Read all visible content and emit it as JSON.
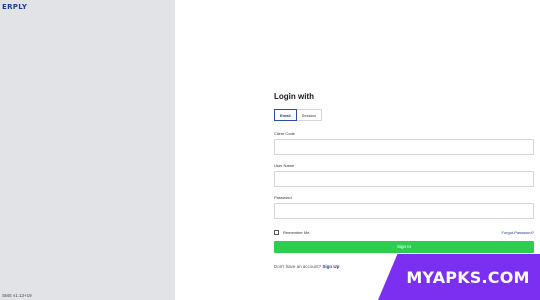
{
  "sidebar": {
    "logo_text": "ERPLY",
    "version": "SMS v1.13+19"
  },
  "login": {
    "title": "Login with",
    "tabs": [
      {
        "label": "Email",
        "active": true
      },
      {
        "label": "Session",
        "active": false
      }
    ],
    "fields": {
      "client_code": {
        "label": "Client Code",
        "value": ""
      },
      "username": {
        "label": "User Name",
        "value": ""
      },
      "password": {
        "label": "Password",
        "value": ""
      }
    },
    "remember_label": "Remember Me",
    "remember_checked": false,
    "forgot_label": "Forgot Password?",
    "signin_label": "Sign In",
    "signup_prompt": "Don't have an account?",
    "signup_link": "Sign Up"
  },
  "watermark": {
    "text": "MYAPKS.COM"
  },
  "colors": {
    "brand_blue": "#1f3e8f",
    "signin_green": "#2dce4f",
    "left_panel_gray": "#e1e3e6",
    "watermark_purple": "#7b2ff0"
  }
}
